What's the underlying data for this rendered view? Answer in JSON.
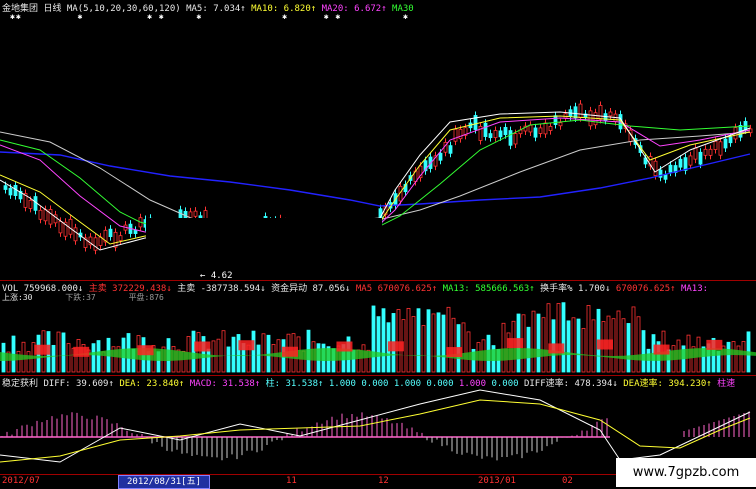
{
  "price_header": {
    "stock_name": "金地集团",
    "period": "日线",
    "ma_def": "MA(5,10,20,30,60,120)",
    "ma5_label": "MA5:",
    "ma5_value": "7.034↑",
    "ma10_label": "MA10:",
    "ma10_value": "6.820↑",
    "ma20_label": "MA20:",
    "ma20_value": "6.672↑",
    "ma30_label": "MA30"
  },
  "price_panel": {
    "min_label": "4.62"
  },
  "volume_header": {
    "vol_label": "VOL",
    "vol_value": "759968.000↓",
    "zhumai_label": "主卖",
    "zhumai_value": "372229.438↓",
    "zhumai2_label": "主卖",
    "zhumai2_value": "-387738.594↓",
    "zijin_label": "资金异动",
    "zijin_value": "87.056↓",
    "ma5_label": "MA5",
    "ma5_value": "670076.625↑",
    "ma13_label": "MA13:",
    "ma13_value": "585666.563↑",
    "hsl_label": "换手率%",
    "hsl_value": "1.700↓",
    "extra_value": "670076.625↑",
    "extra_label": "MA13:"
  },
  "volume_sub": {
    "up_label": "上涨:30",
    "down_label": "下跌:37",
    "flat_label": "平盘:876"
  },
  "macd_header": {
    "name": "稳定获利",
    "diff_label": "DIFF:",
    "diff_value": "39.609↑",
    "dea_label": "DEA:",
    "dea_value": "23.840↑",
    "macd_label": "MACD:",
    "macd_value": "31.538↑",
    "zhu_label": "柱:",
    "zhu_value": "31.538↑",
    "v1": "1.000",
    "v2": "0.000",
    "v3": "1.000",
    "v4": "0.000",
    "v5": "1.000",
    "v6": "0.000",
    "diff_speed_label": "DIFF速率:",
    "diff_speed_value": "478.394↓",
    "dea_speed_label": "DEA速率:",
    "dea_speed_value": "394.230↑",
    "tail_label": "柱速"
  },
  "date_axis": {
    "d1": "2012/07",
    "selected": "2012/08/31[五]",
    "d3": "11",
    "d4": "12",
    "d5": "2013/01",
    "d6": "02"
  },
  "watermark": "www.7gpzb.com",
  "colors": {
    "up": "#ff3333",
    "down": "#33ffff",
    "ma5": "#ffffff",
    "ma10": "#ffff33",
    "ma20": "#ff44ff",
    "ma30": "#33ff33",
    "ma60": "#2222ff",
    "ma120": "#cccccc"
  }
}
